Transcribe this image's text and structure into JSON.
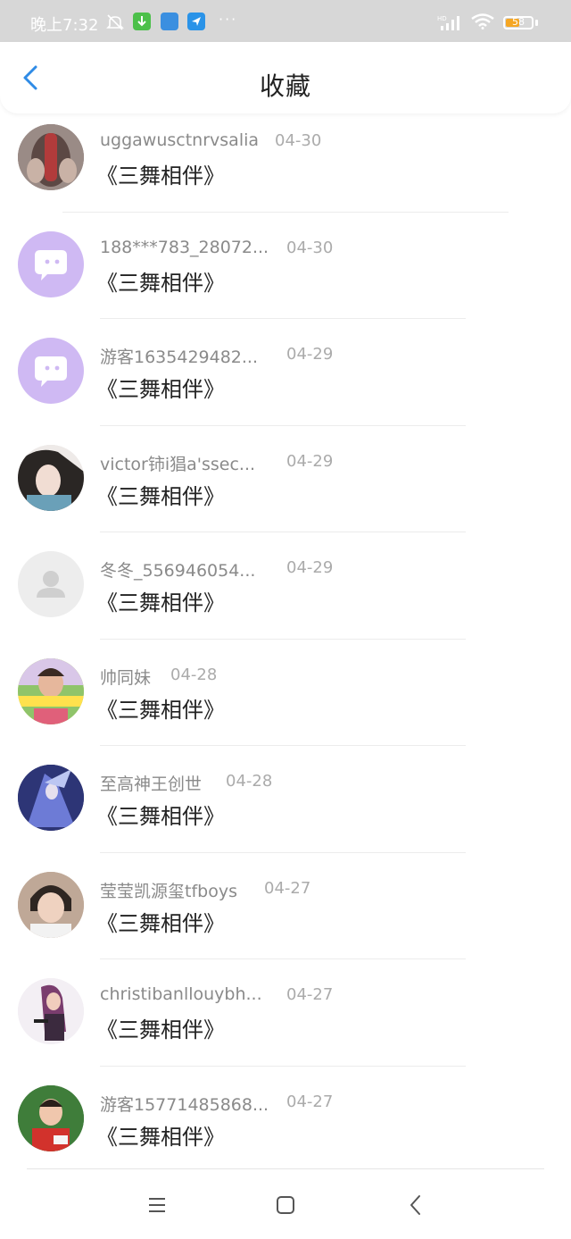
{
  "status_bar": {
    "time": "晚上7:32",
    "dots": "···",
    "signal_label": "HD",
    "battery_level": "58"
  },
  "header": {
    "title": "收藏"
  },
  "items": [
    {
      "user": "uggawusctnrvsalia",
      "date": "04-30",
      "title": "《三舞相伴》"
    },
    {
      "user": "188***783_28072...",
      "date": "04-30",
      "title": "《三舞相伴》"
    },
    {
      "user": "游客1635429482...",
      "date": "04-29",
      "title": "《三舞相伴》"
    },
    {
      "user": "victor铈i猖a'ssec...",
      "date": "04-29",
      "title": "《三舞相伴》"
    },
    {
      "user": "冬冬_556946054...",
      "date": "04-29",
      "title": "《三舞相伴》"
    },
    {
      "user": "帅同妹",
      "date": "04-28",
      "title": "《三舞相伴》"
    },
    {
      "user": "至高神王创世",
      "date": "04-28",
      "title": "《三舞相伴》"
    },
    {
      "user": "莹莹凯源玺tfboys",
      "date": "04-27",
      "title": "《三舞相伴》"
    },
    {
      "user": "christibanllouybh...",
      "date": "04-27",
      "title": "《三舞相伴》"
    },
    {
      "user": "游客15771485868...",
      "date": "04-27",
      "title": "《三舞相伴》"
    }
  ],
  "colors": {
    "accent": "#2f8be6",
    "chat_avatar_bg": "#cfb9f3",
    "default_avatar_bg": "#ededed"
  }
}
